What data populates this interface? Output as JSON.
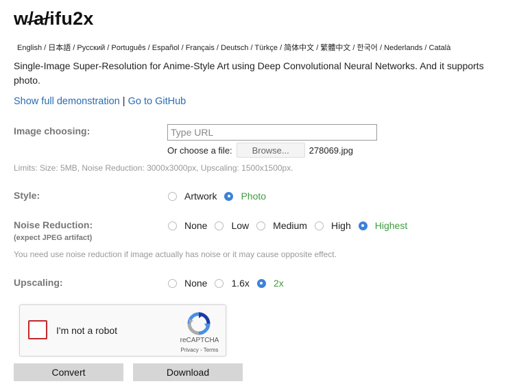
{
  "header": {
    "logo_part1": "w",
    "logo_strike": "/a/",
    "logo_part2": "ifu2x"
  },
  "languages": [
    "English",
    "日本語",
    "Русский",
    "Português",
    "Español",
    "Français",
    "Deutsch",
    "Türkçe",
    "简体中文",
    "繁體中文",
    "한국어",
    "Nederlands",
    "Català"
  ],
  "language_separator": " / ",
  "tagline": "Single-Image Super-Resolution for Anime-Style Art using Deep Convolutional Neural Networks. And it supports photo.",
  "links": {
    "demo": "Show full demonstration",
    "separator": " | ",
    "github": "Go to GitHub"
  },
  "image": {
    "label": "Image choosing:",
    "url_placeholder": "Type URL",
    "url_value": "",
    "choose_file_text": "Or choose a file:",
    "browse_label": "Browse...",
    "file_name": "278069.jpg",
    "limits": "Limits: Size: 5MB, Noise Reduction: 3000x3000px, Upscaling: 1500x1500px."
  },
  "style": {
    "label": "Style:",
    "options": [
      {
        "label": "Artwork",
        "selected": false
      },
      {
        "label": "Photo",
        "selected": true
      }
    ]
  },
  "noise": {
    "label": "Noise Reduction:",
    "sublabel": "(expect JPEG artifact)",
    "options": [
      {
        "label": "None",
        "selected": false
      },
      {
        "label": "Low",
        "selected": false
      },
      {
        "label": "Medium",
        "selected": false
      },
      {
        "label": "High",
        "selected": false
      },
      {
        "label": "Highest",
        "selected": true
      }
    ],
    "hint": "You need use noise reduction if image actually has noise or it may cause opposite effect."
  },
  "upscaling": {
    "label": "Upscaling:",
    "options": [
      {
        "label": "None",
        "selected": false
      },
      {
        "label": "1.6x",
        "selected": false
      },
      {
        "label": "2x",
        "selected": true
      }
    ]
  },
  "captcha": {
    "checkbox_label": "I'm not a robot",
    "brand": "reCAPTCHA",
    "privacy": "Privacy",
    "link_separator": " - ",
    "terms": "Terms",
    "icon": "recaptcha-icon"
  },
  "actions": {
    "convert": "Convert",
    "download": "Download"
  },
  "colors": {
    "link": "#2a6bb5",
    "selected_option": "#3e9b3e",
    "radio_on": "#3c82d8",
    "captcha_checkbox_border": "#c1272d",
    "button_bg": "#d6d6d6"
  }
}
